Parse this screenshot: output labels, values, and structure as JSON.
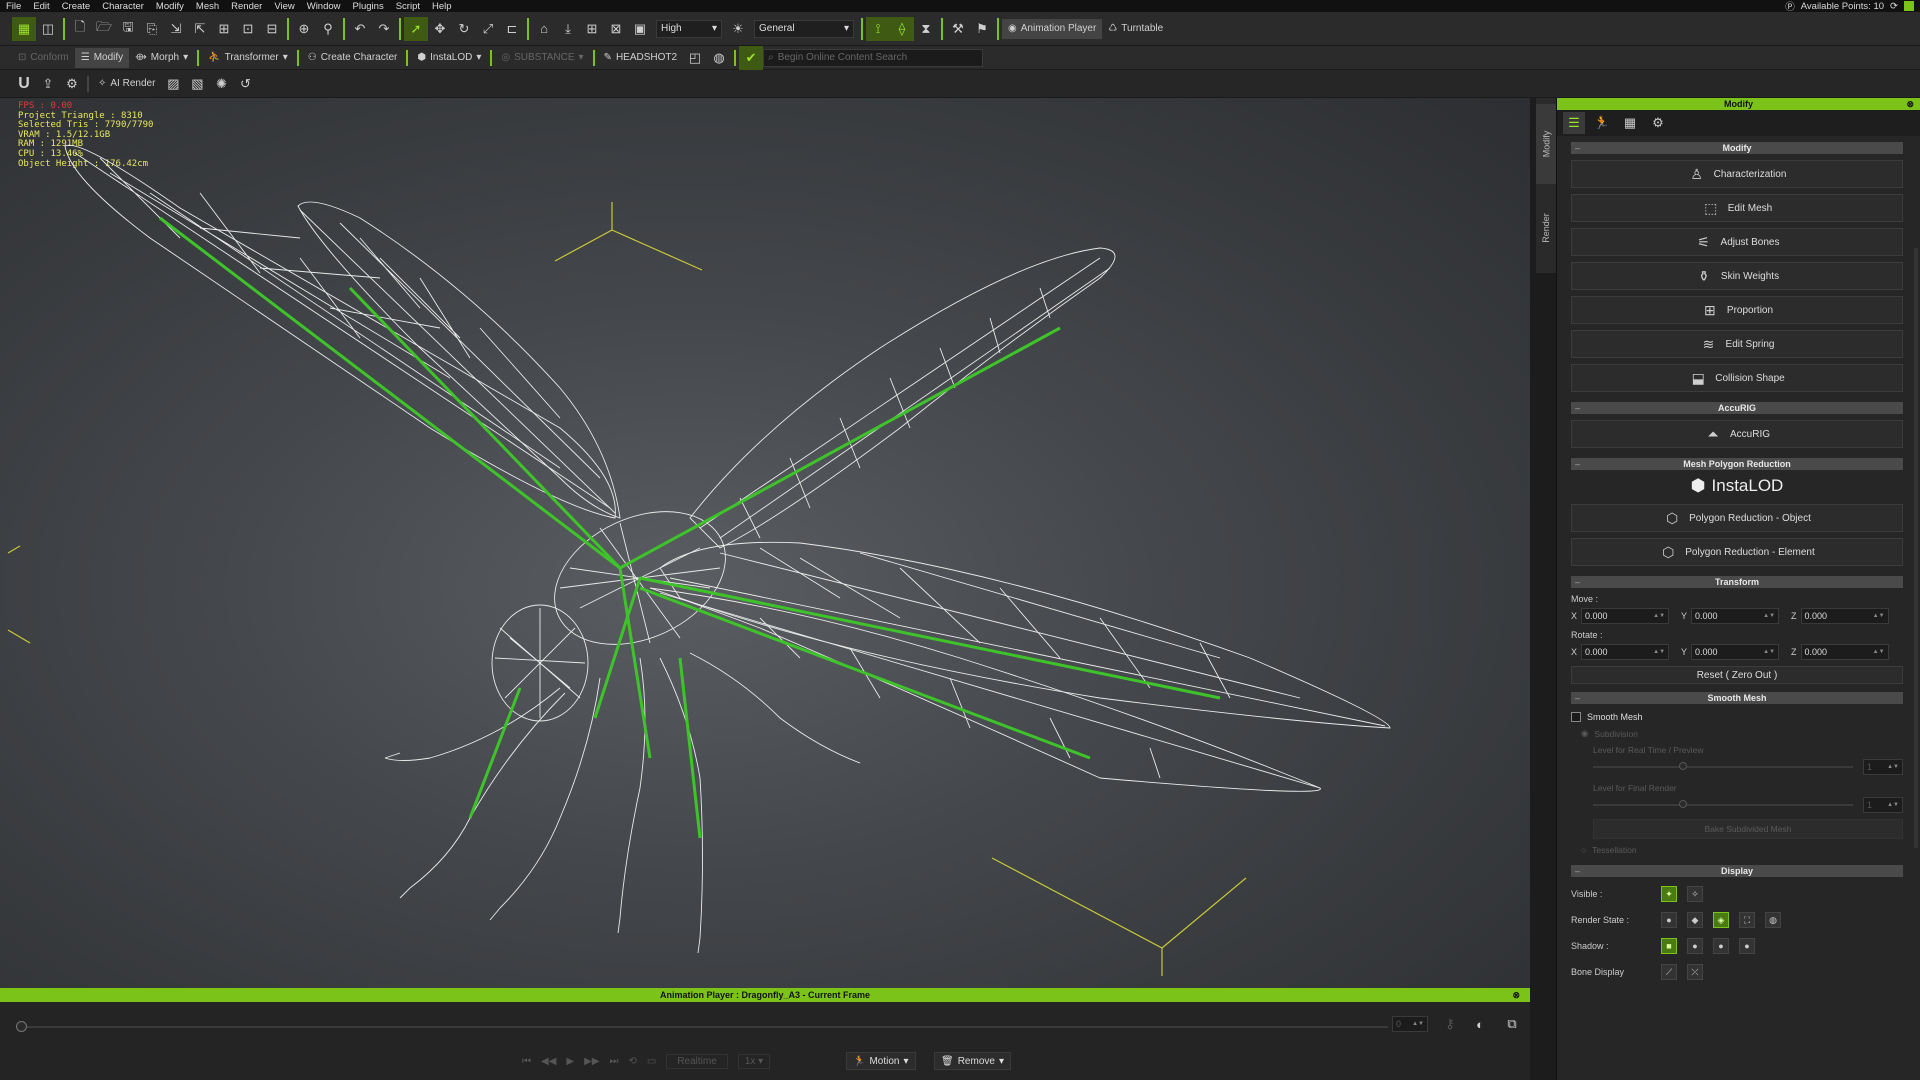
{
  "menubar": {
    "items": [
      "File",
      "Edit",
      "Create",
      "Character",
      "Modify",
      "Mesh",
      "Render",
      "View",
      "Window",
      "Plugins",
      "Script",
      "Help"
    ],
    "available_points": "Available Points: 10"
  },
  "toolbar": {
    "quality": "High",
    "lighting": "General",
    "animation_player": "Animation Player",
    "turntable": "Turntable"
  },
  "toolbar2": {
    "conform": "Conform",
    "modify": "Modify",
    "morph": "Morph",
    "transformer": "Transformer",
    "create_character": "Create Character",
    "instalod": "InstaLOD",
    "substance": "SUBSTANCE",
    "headshot": "HEADSHOT2",
    "search_placeholder": "Begin Online Content Search"
  },
  "toolbar3": {
    "ai_render": "AI Render"
  },
  "viewport": {
    "stats": {
      "fps": "FPS : 0.00",
      "project_triangle": "Project Triangle : 8310",
      "selected_tris": "Selected Tris : 7790/7790",
      "vram": "VRAM : 1.5/12.1GB",
      "ram": "RAM : 1291MB",
      "cpu": "CPU : 13.46%",
      "object_height": "Object Height : 176.42cm"
    }
  },
  "sidetabs": {
    "modify": "Modify",
    "render": "Render"
  },
  "panel": {
    "title": "Modify",
    "sections": {
      "modify": "Modify",
      "accurig": "AccuRIG",
      "mesh_reduction": "Mesh Polygon Reduction",
      "transform": "Transform",
      "smooth_mesh": "Smooth Mesh",
      "display": "Display"
    },
    "modify_buttons": [
      {
        "label": "Characterization",
        "icon": "figure-icon"
      },
      {
        "label": "Edit Mesh",
        "icon": "edit-mesh-icon"
      },
      {
        "label": "Adjust Bones",
        "icon": "bones-icon"
      },
      {
        "label": "Skin Weights",
        "icon": "skin-weights-icon"
      },
      {
        "label": "Proportion",
        "icon": "proportion-icon"
      },
      {
        "label": "Edit Spring",
        "icon": "spring-icon"
      },
      {
        "label": "Collision Shape",
        "icon": "collision-icon"
      }
    ],
    "accurig_button": "AccuRIG",
    "instalod_logo": "InstaLOD",
    "reduction_object": "Polygon Reduction - Object",
    "reduction_element": "Polygon Reduction - Element",
    "move_label": "Move :",
    "rotate_label": "Rotate :",
    "move": {
      "x": "0.000",
      "y": "0.000",
      "z": "0.000"
    },
    "rotate": {
      "x": "0.000",
      "y": "0.000",
      "z": "0.000"
    },
    "axis": {
      "x": "X",
      "y": "Y",
      "z": "Z"
    },
    "reset": "Reset ( Zero Out )",
    "smooth_mesh_check": "Smooth Mesh",
    "subdivision": "Subdivision",
    "level_realtime": "Level for Real Time / Preview",
    "level_final": "Level for Final Render",
    "level_realtime_value": "1",
    "level_final_value": "1",
    "bake_mesh": "Bake Subdivided Mesh",
    "tessellation": "Tessellation",
    "display": {
      "visible": "Visible :",
      "render_state": "Render State :",
      "shadow": "Shadow :",
      "bone_display": "Bone Display"
    }
  },
  "anim": {
    "title": "Animation Player : Dragonfly_A3 - Current Frame",
    "frame": "0",
    "realtime": "Realtime",
    "speed": "1x",
    "motion": "Motion",
    "remove": "Remove"
  }
}
